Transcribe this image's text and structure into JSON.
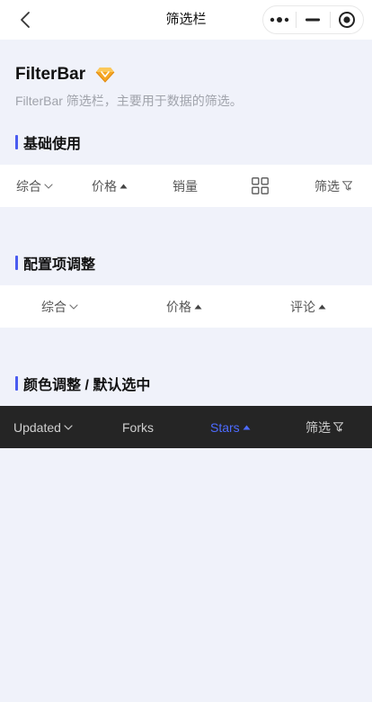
{
  "navbar": {
    "title": "筛选栏",
    "back_icon": "chevron-left-icon",
    "capsule_icons": [
      "more-dots-icon",
      "minimize-icon",
      "target-circle-icon"
    ]
  },
  "header": {
    "title": "FilterBar",
    "badge_icon": "orange-diamond-icon",
    "description": "FilterBar 筛选栏，主要用于数据的筛选。"
  },
  "sections": [
    {
      "title": "基础使用",
      "items": [
        {
          "label": "综合",
          "icon": "chevron-down-icon"
        },
        {
          "label": "价格",
          "icon": "caret-up-icon"
        },
        {
          "label": "销量",
          "icon": ""
        },
        {
          "label": "",
          "icon": "grid-icon"
        },
        {
          "label": "筛选",
          "icon": "filter-icon"
        }
      ]
    },
    {
      "title": "配置项调整",
      "items": [
        {
          "label": "综合",
          "icon": "chevron-down-icon"
        },
        {
          "label": "价格",
          "icon": "caret-up-icon"
        },
        {
          "label": "评论",
          "icon": "caret-up-icon"
        }
      ]
    },
    {
      "title": "颜色调整 / 默认选中",
      "items": [
        {
          "label": "Updated",
          "icon": "chevron-down-icon"
        },
        {
          "label": "Forks",
          "icon": ""
        },
        {
          "label": "Stars",
          "icon": "caret-up-icon",
          "active": true
        },
        {
          "label": "筛选",
          "icon": "filter-icon"
        }
      ]
    }
  ],
  "colors": {
    "accent": "#4a5cf0",
    "active_text": "#4d6bff",
    "dark_bar": "#252525",
    "page_bg": "#f0f2fa"
  }
}
